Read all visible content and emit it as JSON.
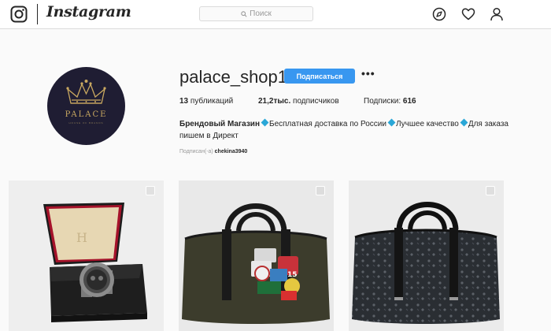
{
  "header": {
    "brand": "Instagram",
    "search_placeholder": "Поиск",
    "icons": [
      "instagram-glyph-icon",
      "search-icon",
      "explore-compass-icon",
      "heart-icon",
      "profile-icon"
    ]
  },
  "profile": {
    "username": "palace_shop1",
    "follow_label": "Подписаться",
    "more_label": "•••",
    "avatar_text": "PALACE",
    "avatar_subtext": "HOUSE OF BRANDS",
    "stats": {
      "posts_value": "13",
      "posts_label": " публикаций",
      "followers_value": "21,2тыс.",
      "followers_label": " подписчиков",
      "following_label": "Подписки: ",
      "following_value": "616"
    },
    "bio": {
      "title": "Брендовый Магазин",
      "part1": "Бесплатная доставка по России",
      "part2": "Лучшее качество",
      "part3": "Для заказа пишем в Директ"
    },
    "followed_by": {
      "label": "Подписан(-а) ",
      "user": "chekina3940"
    }
  },
  "posts": [
    {
      "subject": "luxury-watch-in-box"
    },
    {
      "subject": "olive-duffel-bag-with-patches"
    },
    {
      "subject": "monogram-duffel-bag"
    }
  ],
  "colors": {
    "accent": "#3897f0",
    "diamond": "#2aa7d7",
    "avatar_bg": "#1f1d33",
    "avatar_gold": "#c9a860"
  }
}
